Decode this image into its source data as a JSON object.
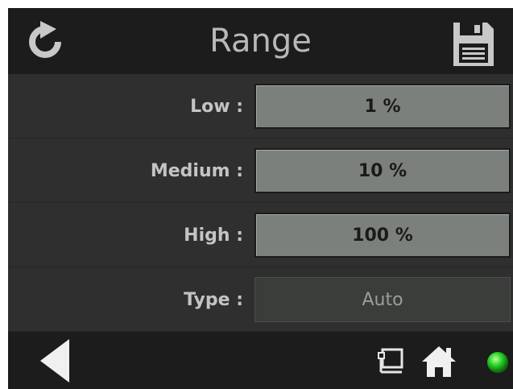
{
  "header": {
    "title": "Range",
    "refresh_icon": "refresh-icon",
    "save_icon": "save-icon"
  },
  "rows": [
    {
      "label": "Low :",
      "value": "1 %"
    },
    {
      "label": "Medium :",
      "value": "10 %"
    },
    {
      "label": "High :",
      "value": "100 %"
    },
    {
      "label": "Type :",
      "value": "Auto"
    }
  ],
  "footer": {
    "back_icon": "back-arrow-icon",
    "network_icon": "network-icon",
    "home_icon": "home-icon",
    "status_icon": "status-led-icon",
    "status_color": "#22cc22"
  },
  "colors": {
    "background": "#2f2f2f",
    "bar": "#1c1c1c",
    "value_field": "#7c807c"
  }
}
